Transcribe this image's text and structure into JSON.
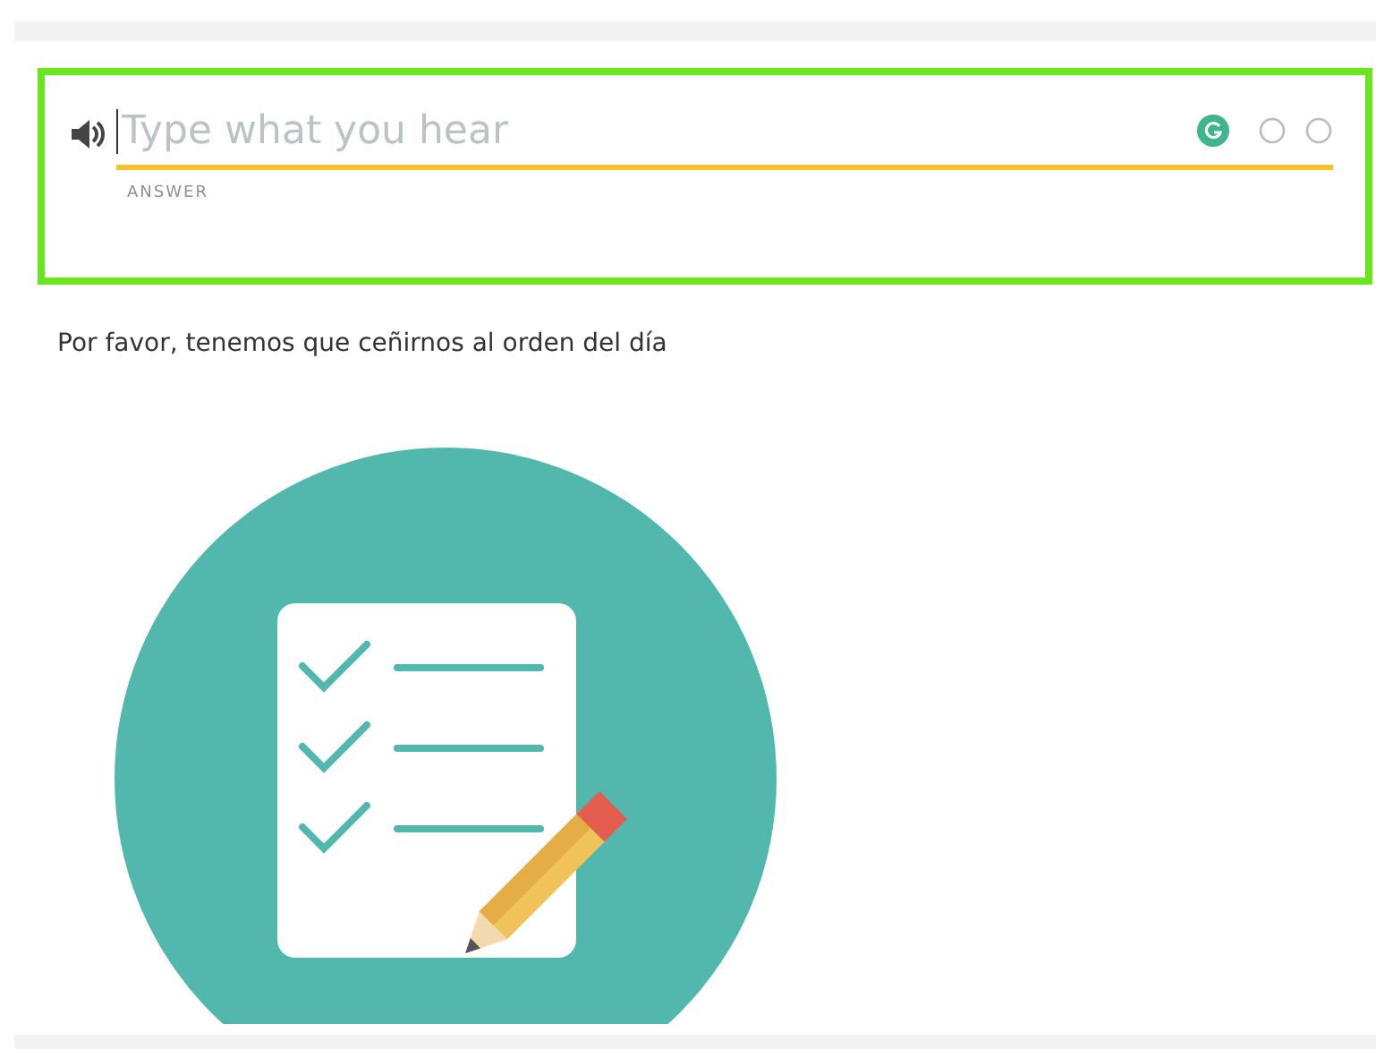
{
  "answer": {
    "placeholder": "Type what you hear",
    "label": "ANSWER",
    "highlighted": true
  },
  "prompt": "Por favor, tenemos que ceñirnos al orden del día"
}
